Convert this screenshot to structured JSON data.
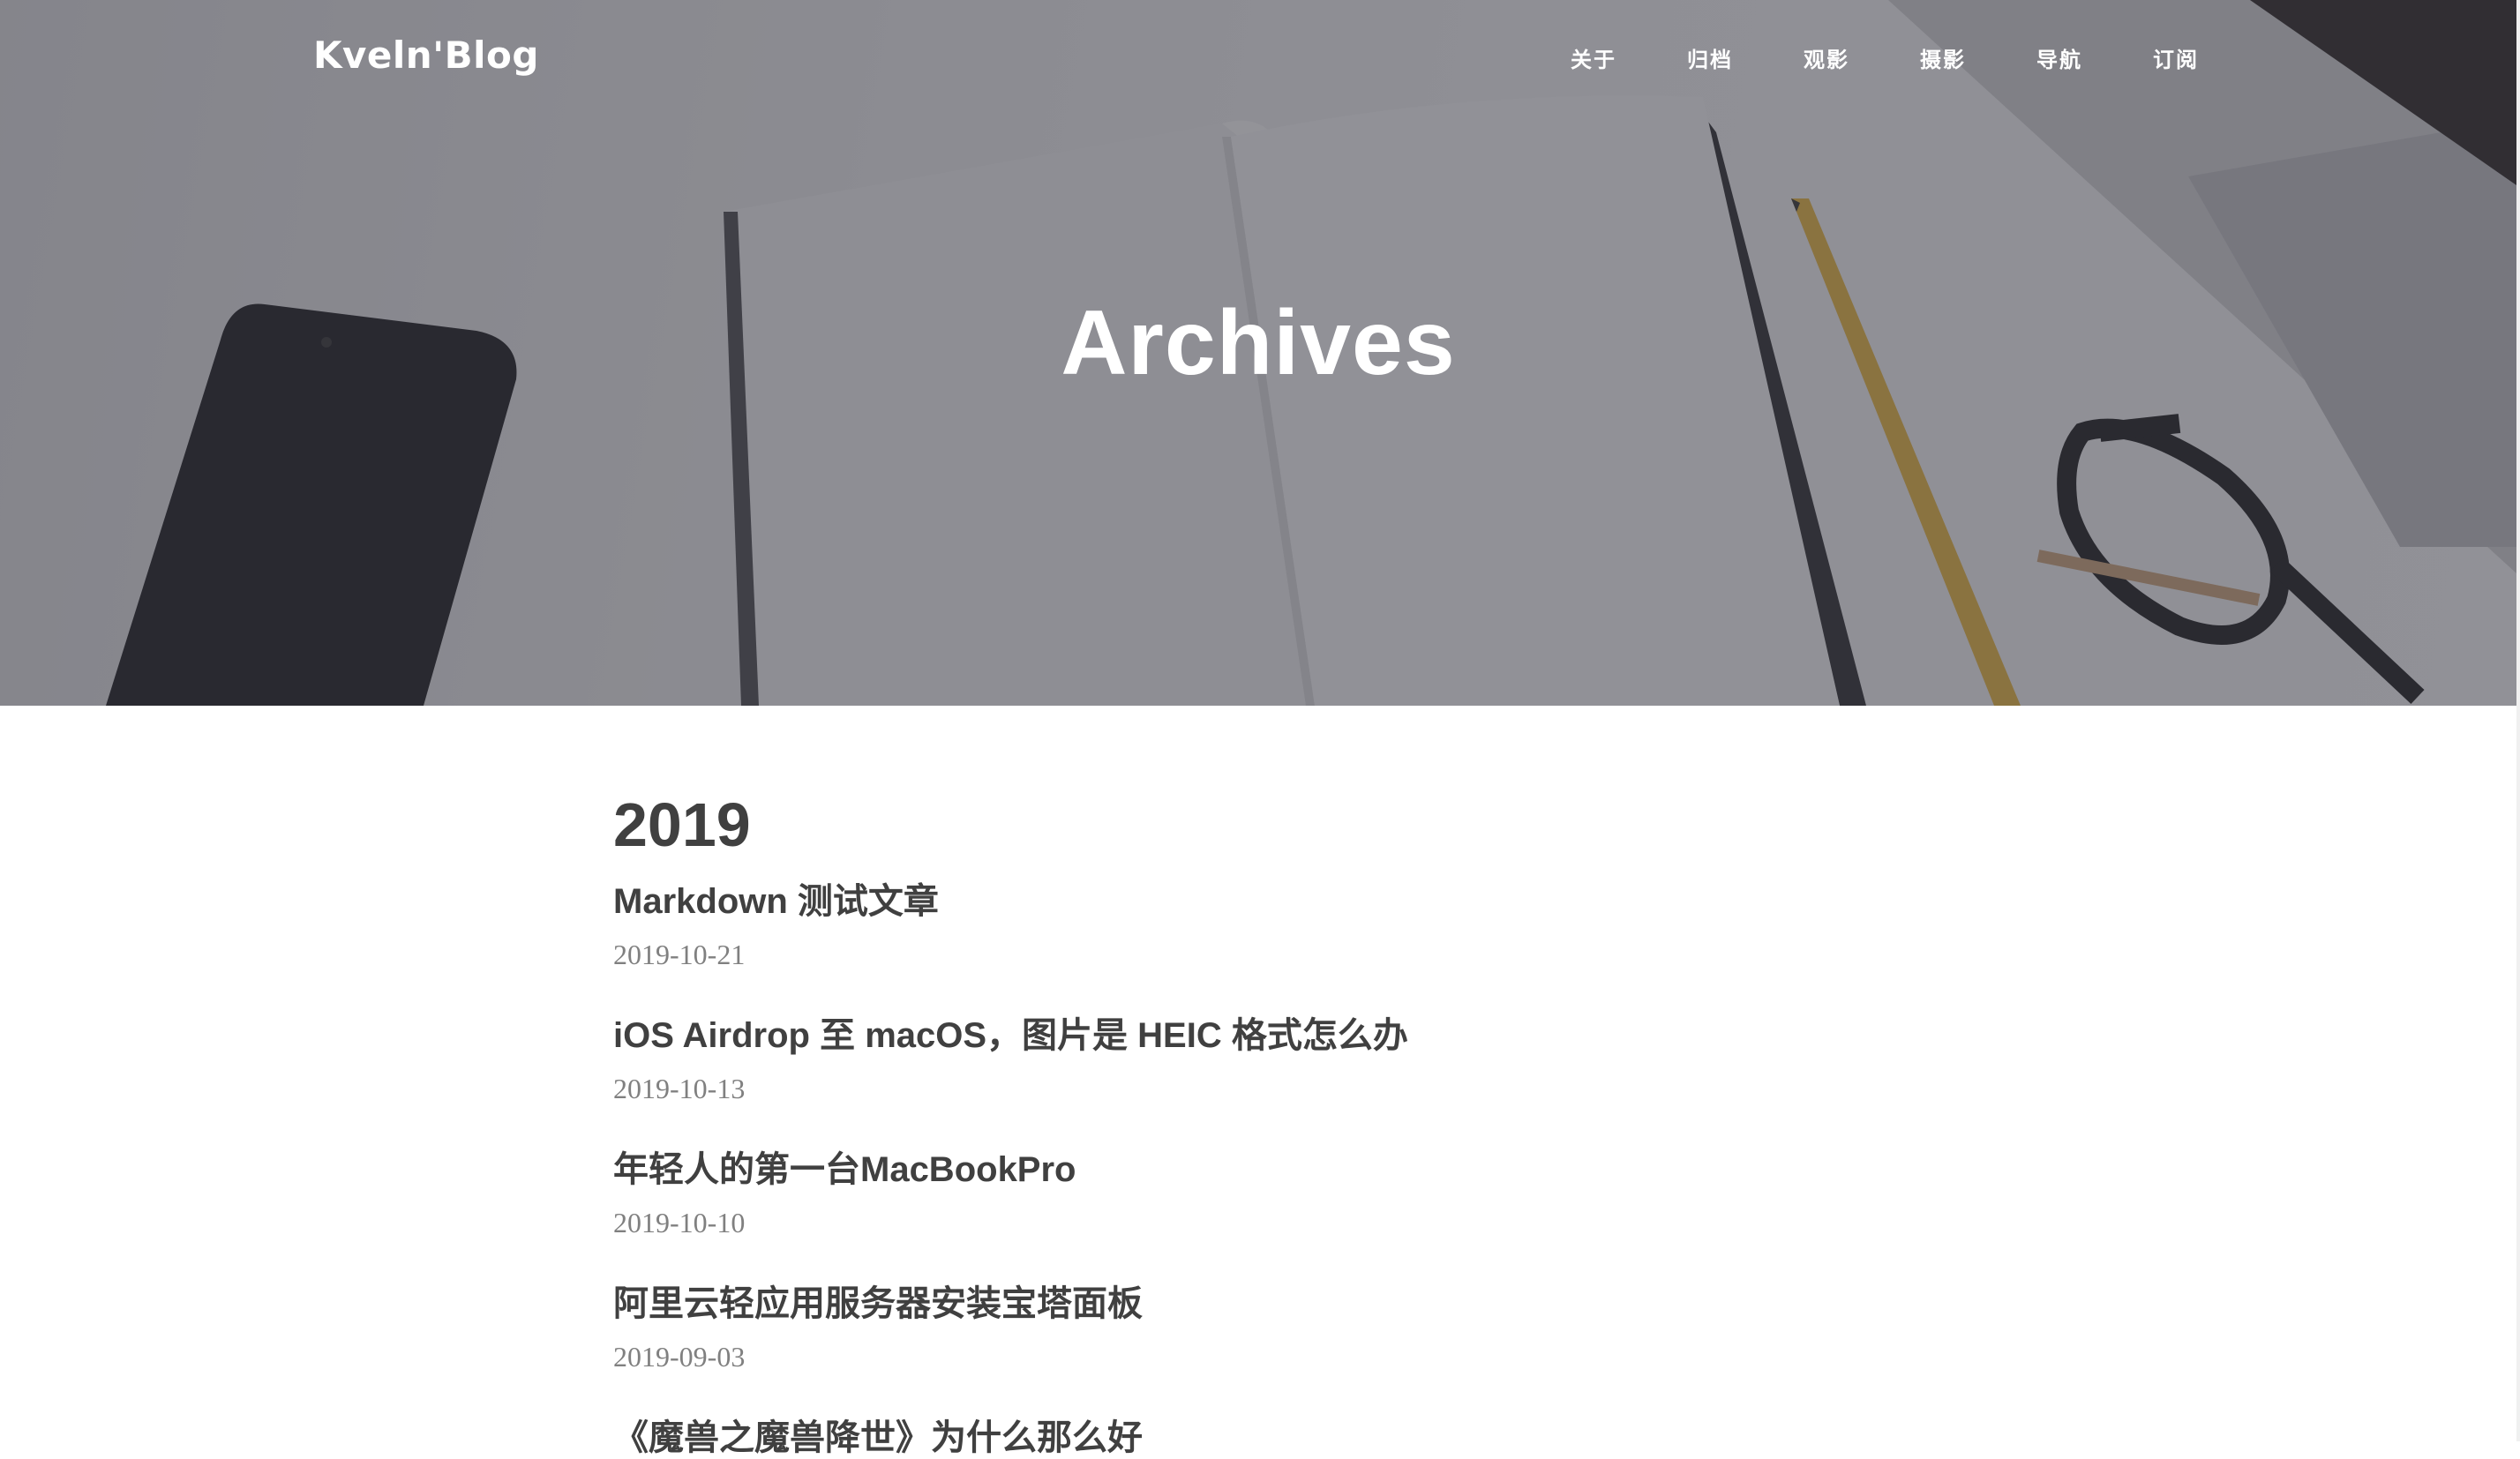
{
  "brand": "Kveln'Blog",
  "nav": {
    "items": [
      "关于",
      "归档",
      "观影",
      "摄影",
      "导航",
      "订阅"
    ]
  },
  "hero": {
    "title": "Archives"
  },
  "archive": {
    "year": "2019",
    "posts": [
      {
        "title": "Markdown 测试文章",
        "date": "2019-10-21"
      },
      {
        "title": "iOS Airdrop 至 macOS，图片是 HEIC 格式怎么办",
        "date": "2019-10-13"
      },
      {
        "title": "年轻人的第一台MacBookPro",
        "date": "2019-10-10"
      },
      {
        "title": "阿里云轻应用服务器安装宝塔面板",
        "date": "2019-09-03"
      },
      {
        "title": "《魔兽之魔兽降世》为什么那么好",
        "date": ""
      }
    ]
  },
  "colors": {
    "hero_overlay": "#37374188",
    "text_primary": "#404040",
    "text_muted": "#808080"
  }
}
